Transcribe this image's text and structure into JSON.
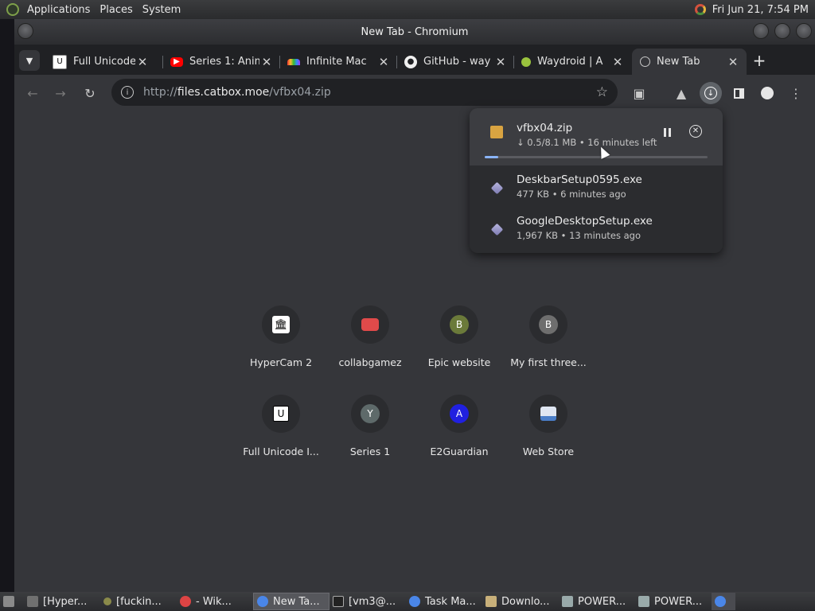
{
  "top_panel": {
    "menus": [
      "Applications",
      "Places",
      "System"
    ],
    "clock": "Fri Jun 21,  7:54 PM"
  },
  "window": {
    "title": "New Tab - Chromium"
  },
  "tabs": [
    {
      "title": "Full Unicode",
      "icon": "unicode-favicon",
      "active": false
    },
    {
      "title": "Series 1: Anim",
      "icon": "youtube-favicon",
      "active": false
    },
    {
      "title": "Infinite Mac",
      "icon": "rainbow-favicon",
      "active": false
    },
    {
      "title": "GitHub - way",
      "icon": "github-favicon",
      "active": false
    },
    {
      "title": "Waydroid | A",
      "icon": "waydroid-favicon",
      "active": false
    },
    {
      "title": "New Tab",
      "icon": "globe-favicon",
      "active": true
    }
  ],
  "omnibox": {
    "scheme": "http://",
    "host": "files.catbox.moe",
    "path": "/vfbx04.zip"
  },
  "downloads": [
    {
      "name": "vfbx04.zip",
      "status": "↓ 0.5/8.1 MB • 16 minutes left",
      "progress": 0.06,
      "in_progress": true,
      "icon": "zip-archive-icon"
    },
    {
      "name": "DeskbarSetup0595.exe",
      "status": "477 KB • 6 minutes ago",
      "in_progress": false,
      "icon": "exe-icon"
    },
    {
      "name": "GoogleDesktopSetup.exe",
      "status": "1,967 KB • 13 minutes ago",
      "in_progress": false,
      "icon": "exe-icon"
    }
  ],
  "shortcuts": [
    {
      "label": "HyperCam 2",
      "letter": "",
      "icon": "museum-icon",
      "color": "#000000"
    },
    {
      "label": "collabgamez",
      "letter": "",
      "icon": "gamepad-icon",
      "color": "#e04a4a"
    },
    {
      "label": "Epic website",
      "letter": "B",
      "icon": "letter-icon",
      "color": "#6b7a3a"
    },
    {
      "label": "My first three...",
      "letter": "B",
      "icon": "letter-icon",
      "color": "#6e6e6e"
    },
    {
      "label": "Full Unicode I...",
      "letter": "",
      "icon": "unicode-icon",
      "color": "#ffffff"
    },
    {
      "label": "Series 1",
      "letter": "Y",
      "icon": "letter-icon",
      "color": "#5e6a6a"
    },
    {
      "label": "E2Guardian",
      "letter": "A",
      "icon": "letter-icon",
      "color": "#2020e0"
    },
    {
      "label": "Web Store",
      "letter": "",
      "icon": "webstore-icon",
      "color": "#4a7ec8"
    }
  ],
  "taskbar": [
    {
      "label": "[Hyper...",
      "icon": "app-icon",
      "active": false
    },
    {
      "label": "[fuckin...",
      "icon": "app-icon",
      "active": false
    },
    {
      "label": "- Wik...",
      "icon": "browser-icon",
      "active": false
    },
    {
      "label": "New Ta...",
      "icon": "chromium-icon",
      "active": true
    },
    {
      "label": "[vm3@...",
      "icon": "terminal-icon",
      "active": false
    },
    {
      "label": "Task Ma...",
      "icon": "chromium-icon",
      "active": false
    },
    {
      "label": "Downlo...",
      "icon": "folder-icon",
      "active": false
    },
    {
      "label": "POWER...",
      "icon": "app-icon",
      "active": false
    },
    {
      "label": "POWER...",
      "icon": "app-icon",
      "active": false
    }
  ]
}
